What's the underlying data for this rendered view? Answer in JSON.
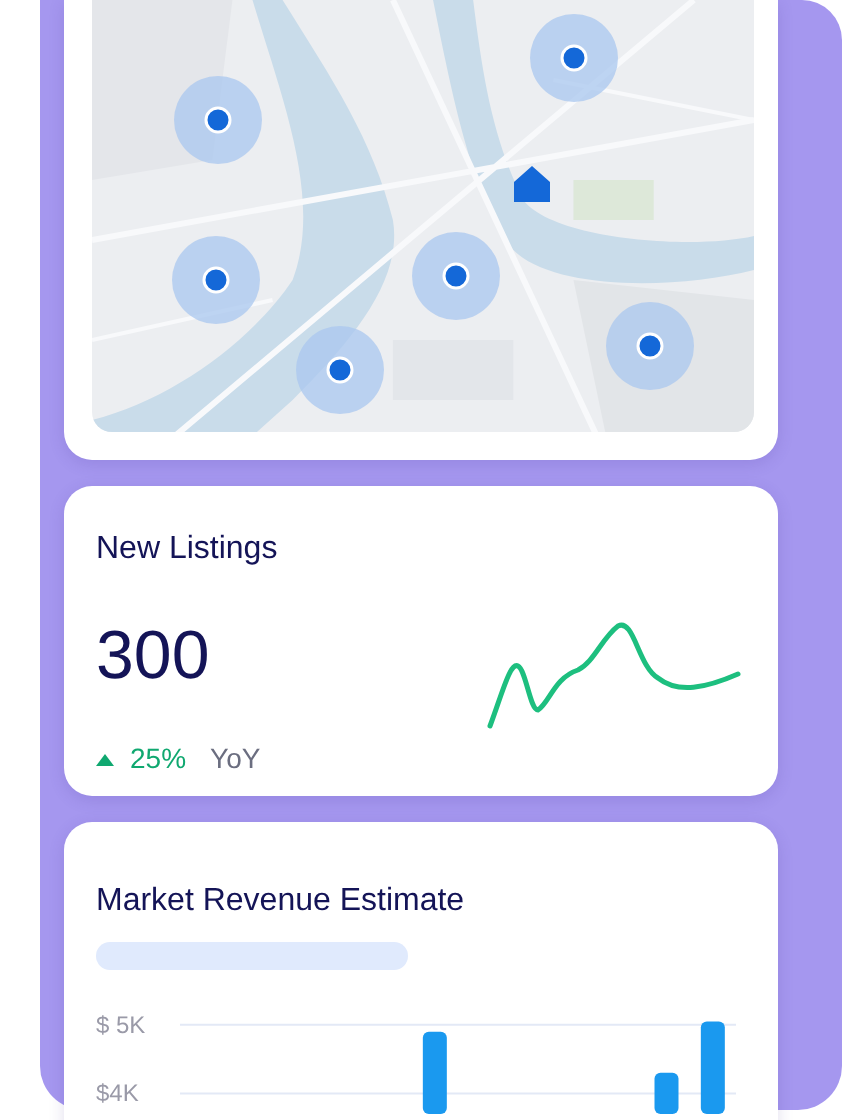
{
  "map": {
    "kind": "picture",
    "pins": [
      {
        "kind": "dot"
      },
      {
        "kind": "dot"
      },
      {
        "kind": "dot"
      },
      {
        "kind": "dot"
      },
      {
        "kind": "dot"
      },
      {
        "kind": "dot"
      },
      {
        "kind": "home"
      }
    ]
  },
  "new_listings": {
    "title": "New Listings",
    "value": "300",
    "rising": true,
    "change": "25%",
    "period": "YoY"
  },
  "revenue": {
    "title": "Market Revenue Estimate",
    "chart_data": {
      "type": "bar",
      "ylim": [
        3700,
        5100
      ],
      "values": [
        null,
        null,
        null,
        null,
        null,
        4900,
        null,
        null,
        null,
        null,
        4300,
        5050
      ],
      "yticks": [
        {
          "value": 5000,
          "label": "$ 5K"
        },
        {
          "value": 4000,
          "label": "$4K"
        }
      ],
      "color": "#1a99ef"
    }
  }
}
